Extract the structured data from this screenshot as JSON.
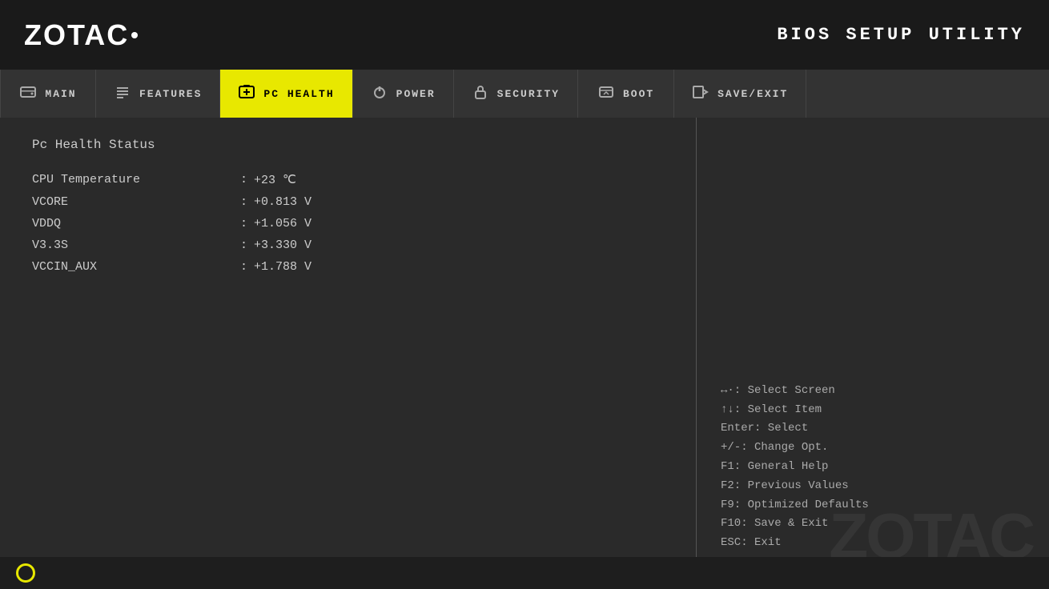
{
  "header": {
    "logo": "ZOTAC",
    "bios_title": "BIOS SETUP UTILITY"
  },
  "nav": {
    "items": [
      {
        "id": "main",
        "label": "MAIN",
        "icon": "hdd",
        "active": false
      },
      {
        "id": "features",
        "label": "FEATURES",
        "icon": "list",
        "active": false
      },
      {
        "id": "pc-health",
        "label": "PC HEALTH",
        "icon": "plus-box",
        "active": true
      },
      {
        "id": "power",
        "label": "POWER",
        "icon": "power",
        "active": false
      },
      {
        "id": "security",
        "label": "SECURITY",
        "icon": "lock",
        "active": false
      },
      {
        "id": "boot",
        "label": "BOOT",
        "icon": "boot",
        "active": false
      },
      {
        "id": "save-exit",
        "label": "SAVE/EXIT",
        "icon": "arrow-exit",
        "active": false
      }
    ]
  },
  "main_content": {
    "section_title": "Pc Health Status",
    "stats": [
      {
        "label": "CPU Temperature",
        "separator": ":",
        "value": "+23 ℃"
      },
      {
        "label": "VCORE",
        "separator": ":",
        "value": "+0.813 V"
      },
      {
        "label": "VDDQ",
        "separator": ":",
        "value": "+1.056 V"
      },
      {
        "label": "V3.3S",
        "separator": ":",
        "value": "+3.330 V"
      },
      {
        "label": "VCCIN_AUX",
        "separator": ":",
        "value": "+1.788 V"
      }
    ]
  },
  "help": {
    "lines": [
      "↔·: Select Screen",
      "↑↓: Select Item",
      "Enter: Select",
      "+/-: Change Opt.",
      "F1: General Help",
      "F2: Previous Values",
      "F9: Optimized Defaults",
      "F10: Save & Exit",
      "ESC: Exit"
    ]
  },
  "watermark": "ZOTAC"
}
